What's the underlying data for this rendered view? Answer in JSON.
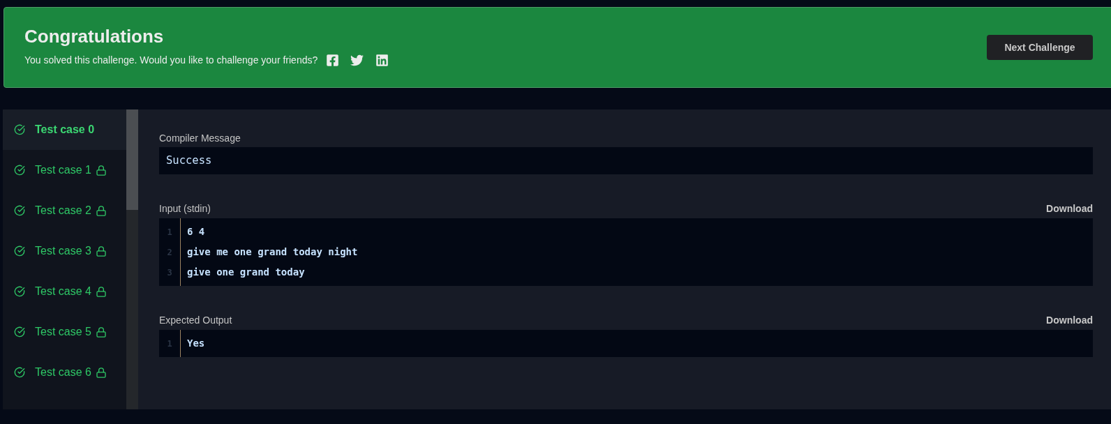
{
  "banner": {
    "title": "Congratulations",
    "message": "You solved this challenge. Would you like to challenge your friends?",
    "button": "Next Challenge"
  },
  "test_cases": [
    {
      "label": "Test case 0",
      "selected": true,
      "passed": true,
      "locked": false
    },
    {
      "label": "Test case 1",
      "selected": false,
      "passed": true,
      "locked": true
    },
    {
      "label": "Test case 2",
      "selected": false,
      "passed": true,
      "locked": true
    },
    {
      "label": "Test case 3",
      "selected": false,
      "passed": true,
      "locked": true
    },
    {
      "label": "Test case 4",
      "selected": false,
      "passed": true,
      "locked": true
    },
    {
      "label": "Test case 5",
      "selected": false,
      "passed": true,
      "locked": true
    },
    {
      "label": "Test case 6",
      "selected": false,
      "passed": true,
      "locked": true
    }
  ],
  "compiler_message": {
    "label": "Compiler Message",
    "value": "Success"
  },
  "input": {
    "label": "Input (stdin)",
    "action": "Download",
    "lines": [
      {
        "number": "1",
        "text": "6 4"
      },
      {
        "number": "2",
        "text": "give me one grand today night"
      },
      {
        "number": "3",
        "text": "give one grand today"
      }
    ]
  },
  "expected_output": {
    "label": "Expected Output",
    "action": "Download",
    "lines": [
      {
        "number": "1",
        "text": "Yes"
      }
    ]
  }
}
